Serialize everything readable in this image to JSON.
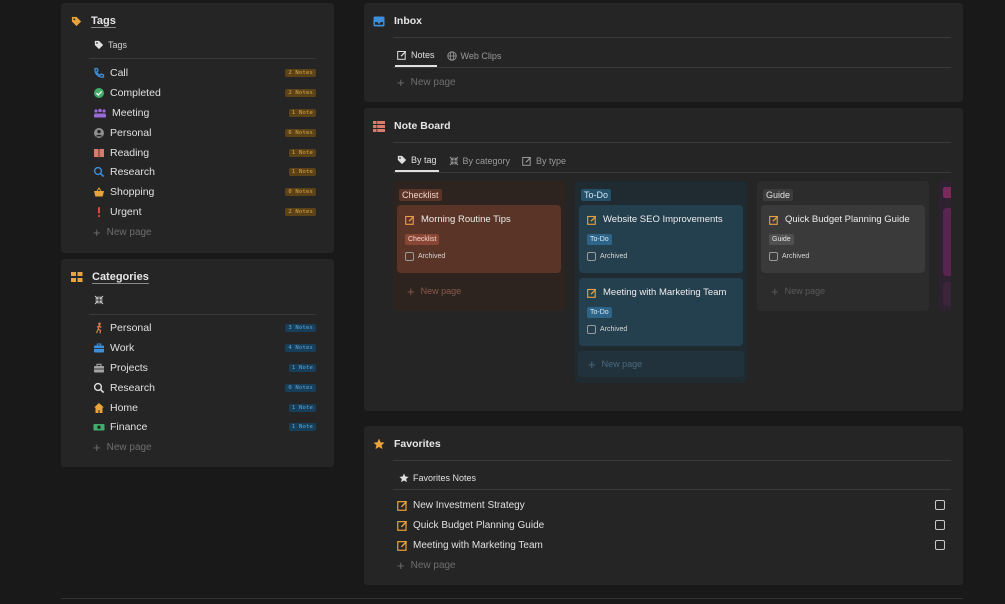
{
  "colors": {
    "accent_orange": "#e8a33d",
    "tag_badge": "#d8a64d",
    "cat_badge": "#5fa8d8",
    "checklist": "#5a3426",
    "todo": "#24404f",
    "guide": "#3a3a3a"
  },
  "tags": {
    "title": "Tags",
    "subtitle": "Tags",
    "items": [
      {
        "label": "Call",
        "badge": "2 Notes",
        "icon": "phone-icon"
      },
      {
        "label": "Completed",
        "badge": "2 Notes",
        "icon": "check-circle-icon"
      },
      {
        "label": "Meeting",
        "badge": "1 Note",
        "icon": "people-icon"
      },
      {
        "label": "Personal",
        "badge": "6 Notes",
        "icon": "user-circle-icon"
      },
      {
        "label": "Reading",
        "badge": "1 Note",
        "icon": "book-icon"
      },
      {
        "label": "Research",
        "badge": "1 Note",
        "icon": "magnifier-icon"
      },
      {
        "label": "Shopping",
        "badge": "0 Notes",
        "icon": "basket-icon"
      },
      {
        "label": "Urgent",
        "badge": "2 Notes",
        "icon": "exclamation-icon"
      }
    ],
    "new_page": "New page"
  },
  "categories": {
    "title": "Categories",
    "items": [
      {
        "label": "Personal",
        "badge": "3 Notes",
        "icon": "person-walking-icon"
      },
      {
        "label": "Work",
        "badge": "4 Notes",
        "icon": "briefcase-icon"
      },
      {
        "label": "Projects",
        "badge": "1 Note",
        "icon": "toolbox-icon"
      },
      {
        "label": "Research",
        "badge": "0 Notes",
        "icon": "magnifier-icon"
      },
      {
        "label": "Home",
        "badge": "1 Note",
        "icon": "house-icon"
      },
      {
        "label": "Finance",
        "badge": "1 Note",
        "icon": "banknote-icon"
      }
    ],
    "new_page": "New page"
  },
  "inbox": {
    "title": "Inbox",
    "tabs": [
      {
        "label": "Notes",
        "active": true
      },
      {
        "label": "Web Clips",
        "active": false
      }
    ],
    "new_page": "New page"
  },
  "board": {
    "title": "Note Board",
    "tabs": [
      {
        "label": "By tag",
        "active": true
      },
      {
        "label": "By category",
        "active": false
      },
      {
        "label": "By type",
        "active": false
      }
    ],
    "columns": [
      {
        "name": "Checklist",
        "cards": [
          {
            "title": "Morning Routine Tips",
            "chip": "Checklist",
            "archived": "Archived"
          }
        ],
        "new_page": "New page"
      },
      {
        "name": "To-Do",
        "cards": [
          {
            "title": "Website SEO Improvements",
            "chip": "To-Do",
            "archived": "Archived"
          },
          {
            "title": "Meeting with Marketing Team",
            "chip": "To-Do",
            "archived": "Archived"
          }
        ],
        "new_page": "New page"
      },
      {
        "name": "Guide",
        "cards": [
          {
            "title": "Quick Budget Planning Guide",
            "chip": "Guide",
            "archived": "Archived"
          }
        ],
        "new_page": "New page"
      }
    ]
  },
  "favorites": {
    "title": "Favorites",
    "subtitle": "Favorites Notes",
    "items": [
      {
        "label": "New Investment Strategy"
      },
      {
        "label": "Quick Budget Planning Guide"
      },
      {
        "label": "Meeting with Marketing Team"
      }
    ],
    "new_page": "New page"
  }
}
